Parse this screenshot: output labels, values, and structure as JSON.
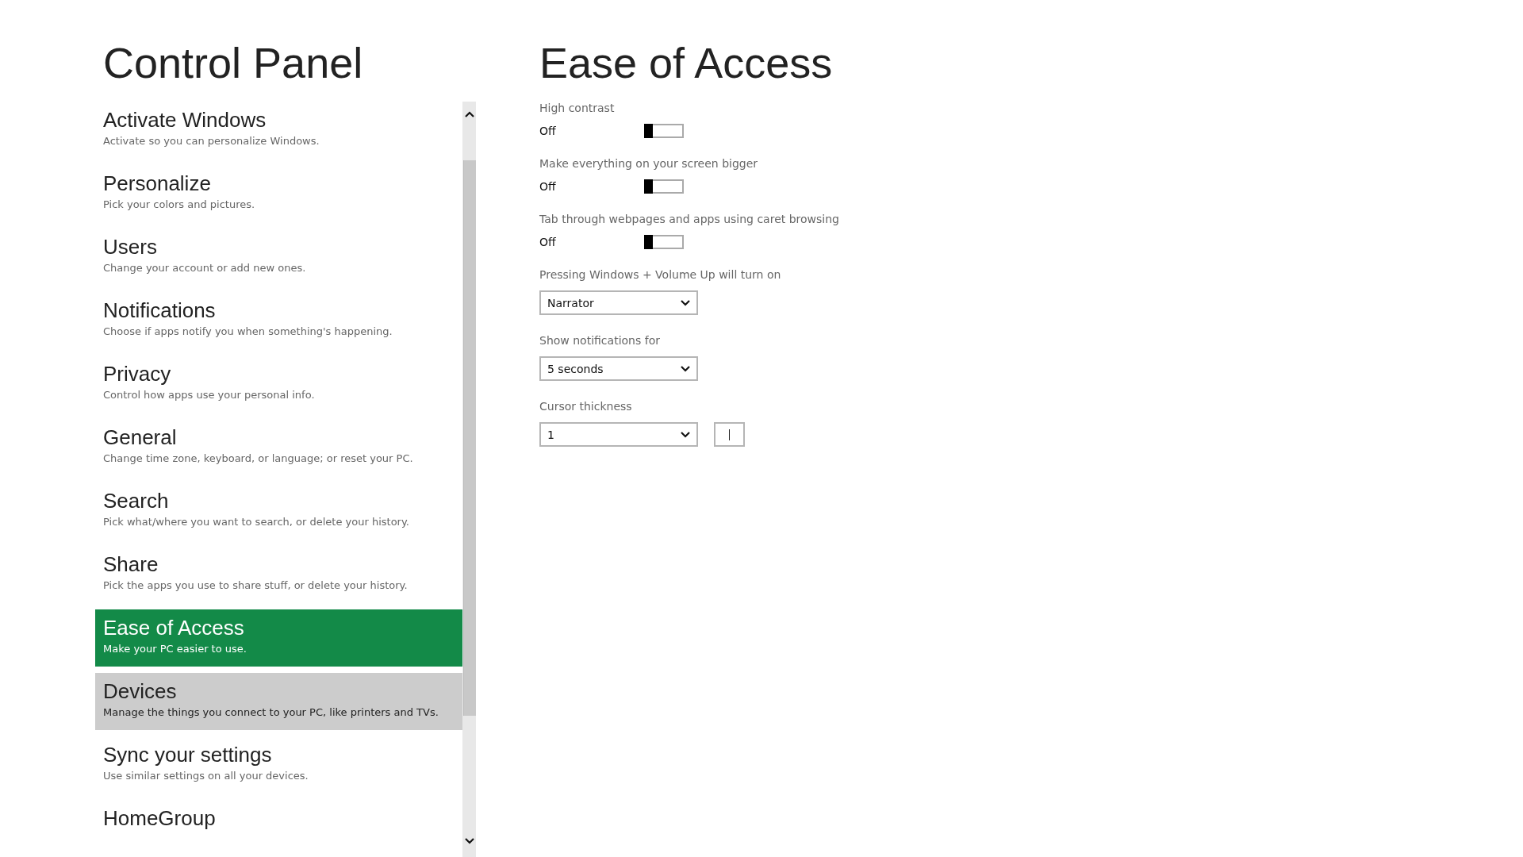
{
  "sidebar": {
    "title": "Control Panel",
    "items": [
      {
        "title": "Activate Windows",
        "description": "Activate so you can personalize Windows.",
        "selected": false,
        "hovered": false
      },
      {
        "title": "Personalize",
        "description": "Pick your colors and pictures.",
        "selected": false,
        "hovered": false
      },
      {
        "title": "Users",
        "description": "Change your account or add new ones.",
        "selected": false,
        "hovered": false
      },
      {
        "title": "Notifications",
        "description": "Choose if apps notify you when something's happening.",
        "selected": false,
        "hovered": false
      },
      {
        "title": "Privacy",
        "description": "Control how apps use your personal info.",
        "selected": false,
        "hovered": false
      },
      {
        "title": "General",
        "description": "Change time zone, keyboard, or language; or reset your PC.",
        "selected": false,
        "hovered": false
      },
      {
        "title": "Search",
        "description": "Pick what/where you want to search, or delete your history.",
        "selected": false,
        "hovered": false
      },
      {
        "title": "Share",
        "description": "Pick the apps you use to share stuff, or delete your history.",
        "selected": false,
        "hovered": false
      },
      {
        "title": "Ease of Access",
        "description": "Make your PC easier to use.",
        "selected": true,
        "hovered": false
      },
      {
        "title": "Devices",
        "description": "Manage the things you connect to your PC, like printers and TVs.",
        "selected": false,
        "hovered": true
      },
      {
        "title": "Sync your settings",
        "description": "Use similar settings on all your devices.",
        "selected": false,
        "hovered": false
      },
      {
        "title": "HomeGroup",
        "selected": false,
        "hovered": false
      }
    ]
  },
  "content": {
    "title": "Ease of Access",
    "settings": [
      {
        "kind": "toggle",
        "label": "High contrast",
        "state_text": "Off",
        "on": false
      },
      {
        "kind": "toggle",
        "label": "Make everything on your screen bigger",
        "state_text": "Off",
        "on": false
      },
      {
        "kind": "toggle",
        "label": "Tab through webpages and apps using caret browsing",
        "state_text": "Off",
        "on": false
      },
      {
        "kind": "dropdown",
        "label": "Pressing Windows + Volume Up will turn on",
        "value": "Narrator"
      },
      {
        "kind": "dropdown",
        "label": "Show notifications for",
        "value": "5 seconds"
      },
      {
        "kind": "cursor",
        "label": "Cursor thickness",
        "value": "1"
      }
    ]
  }
}
